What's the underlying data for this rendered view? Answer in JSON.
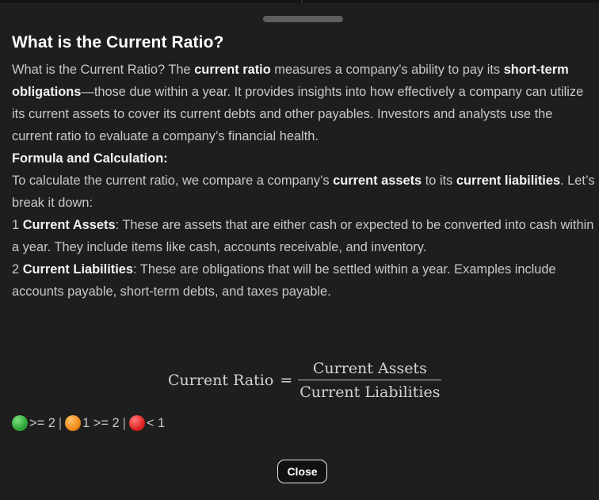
{
  "modal": {
    "title": "What is the Current Ratio?",
    "intro": {
      "t1": "What is the Current Ratio? The ",
      "b1": "current ratio",
      "t2": " measures a company’s ability to pay its ",
      "b2": "short-term obligations",
      "t3": "—those due within a year. It provides insights into how effectively a company can utilize its current assets to cover its current debts and other payables. Investors and analysts use the current ratio to evaluate a company’s financial health."
    },
    "formula_heading": "Formula and Calculation:",
    "calc": {
      "t1": "To calculate the current ratio, we compare a company’s ",
      "b1": "current assets",
      "t2": " to its ",
      "b2": "current liabilities",
      "t3": ". Let’s break it down:"
    },
    "items": [
      {
        "number": "1",
        "term": "Current Assets",
        "text": ": These are assets that are either cash or expected to be converted into cash within a year. They include items like cash, accounts receivable, and inventory."
      },
      {
        "number": "2",
        "term": "Current Liabilities",
        "text": ": These are obligations that will be settled within a year. Examples include accounts payable, short-term debts, and taxes payable."
      }
    ],
    "formula": {
      "lhs": "Current Ratio",
      "equals": "=",
      "numerator": "Current Assets",
      "denominator": "Current Liabilities"
    },
    "legend": {
      "green_text": ">= 2",
      "orange_text": "1 >= 2",
      "red_text": "< 1",
      "separator": "|",
      "colors": {
        "green": "#2fa83a",
        "orange": "#f28c1c",
        "red": "#e02424"
      }
    },
    "close_label": "Close"
  }
}
